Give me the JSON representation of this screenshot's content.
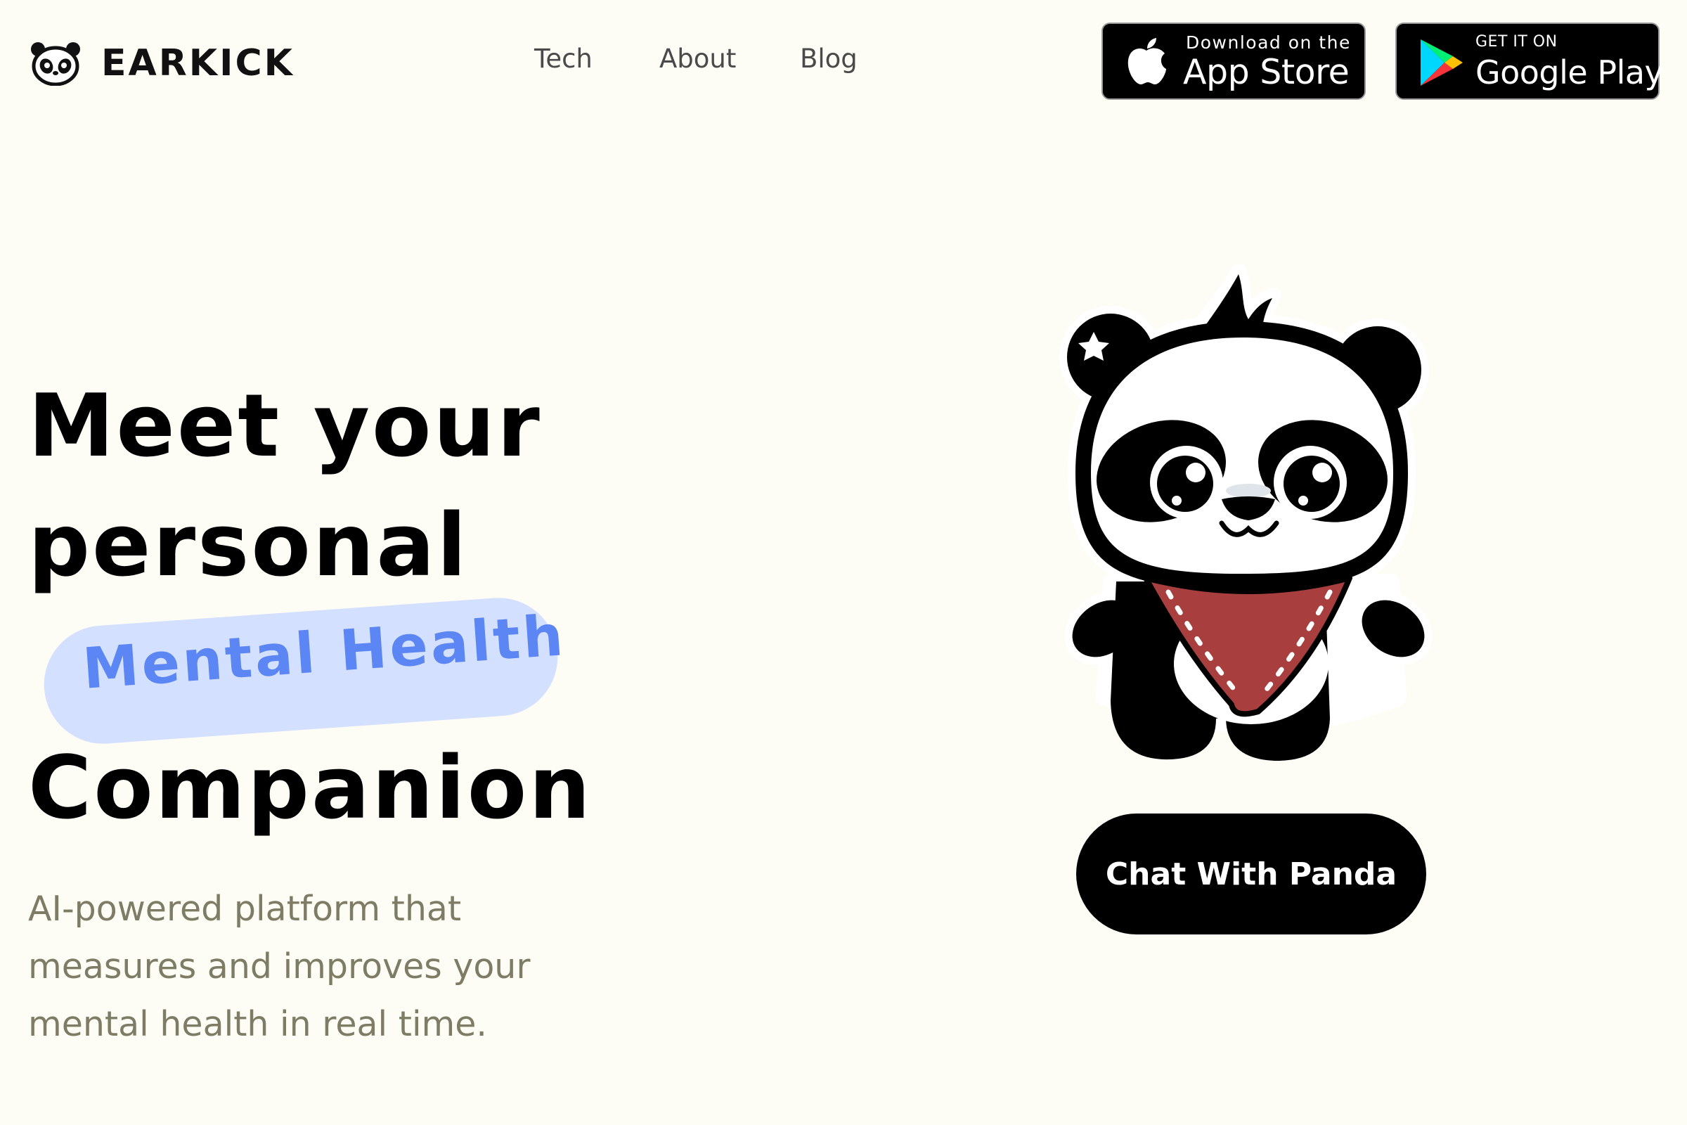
{
  "header": {
    "logo_text": "EARKICK",
    "nav": [
      "Tech",
      "About",
      "Blog"
    ],
    "app_store": {
      "small": "Download on the",
      "big": "App Store",
      "icon": "apple-icon"
    },
    "google_play": {
      "small": "GET IT ON",
      "big": "Google Play",
      "icon": "google-play-icon"
    }
  },
  "hero": {
    "line1": "Meet your",
    "line2": "personal",
    "highlight": "Mental Health",
    "line3": "Companion",
    "subtitle": "AI-powered platform that measures and improves your mental health in real time."
  },
  "cta": {
    "label": "Chat With Panda"
  },
  "colors": {
    "background": "#FEFDF5",
    "highlight_bg": "#D4E0FF",
    "highlight_text": "#5B86F3",
    "subtitle": "#7E7C64",
    "bandana": "#A83E3E"
  }
}
